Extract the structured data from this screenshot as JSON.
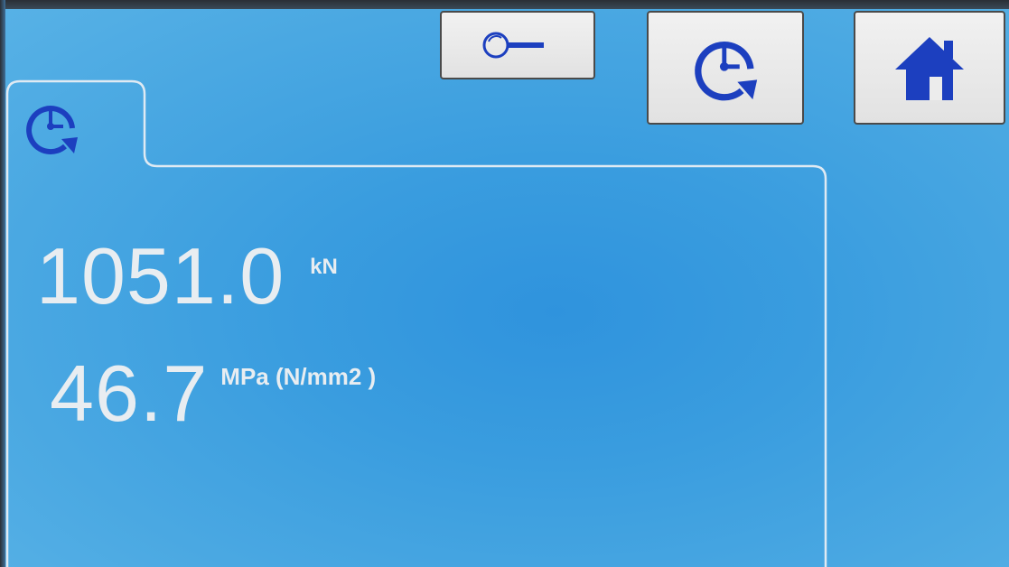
{
  "header": {
    "buttons": [
      {
        "icon": "key-icon"
      },
      {
        "icon": "history-clock-icon"
      },
      {
        "icon": "home-icon"
      }
    ]
  },
  "tab": {
    "icon": "history-clock-icon"
  },
  "readings": {
    "force": {
      "value": "1051.0",
      "unit": "kN"
    },
    "stress": {
      "value": "46.7",
      "unit": "MPa (N/mm2 )"
    }
  },
  "colors": {
    "background": "#3a9ddf",
    "icon": "#1c3fbf",
    "button_face": "#ececec",
    "text": "#e8edf1"
  }
}
